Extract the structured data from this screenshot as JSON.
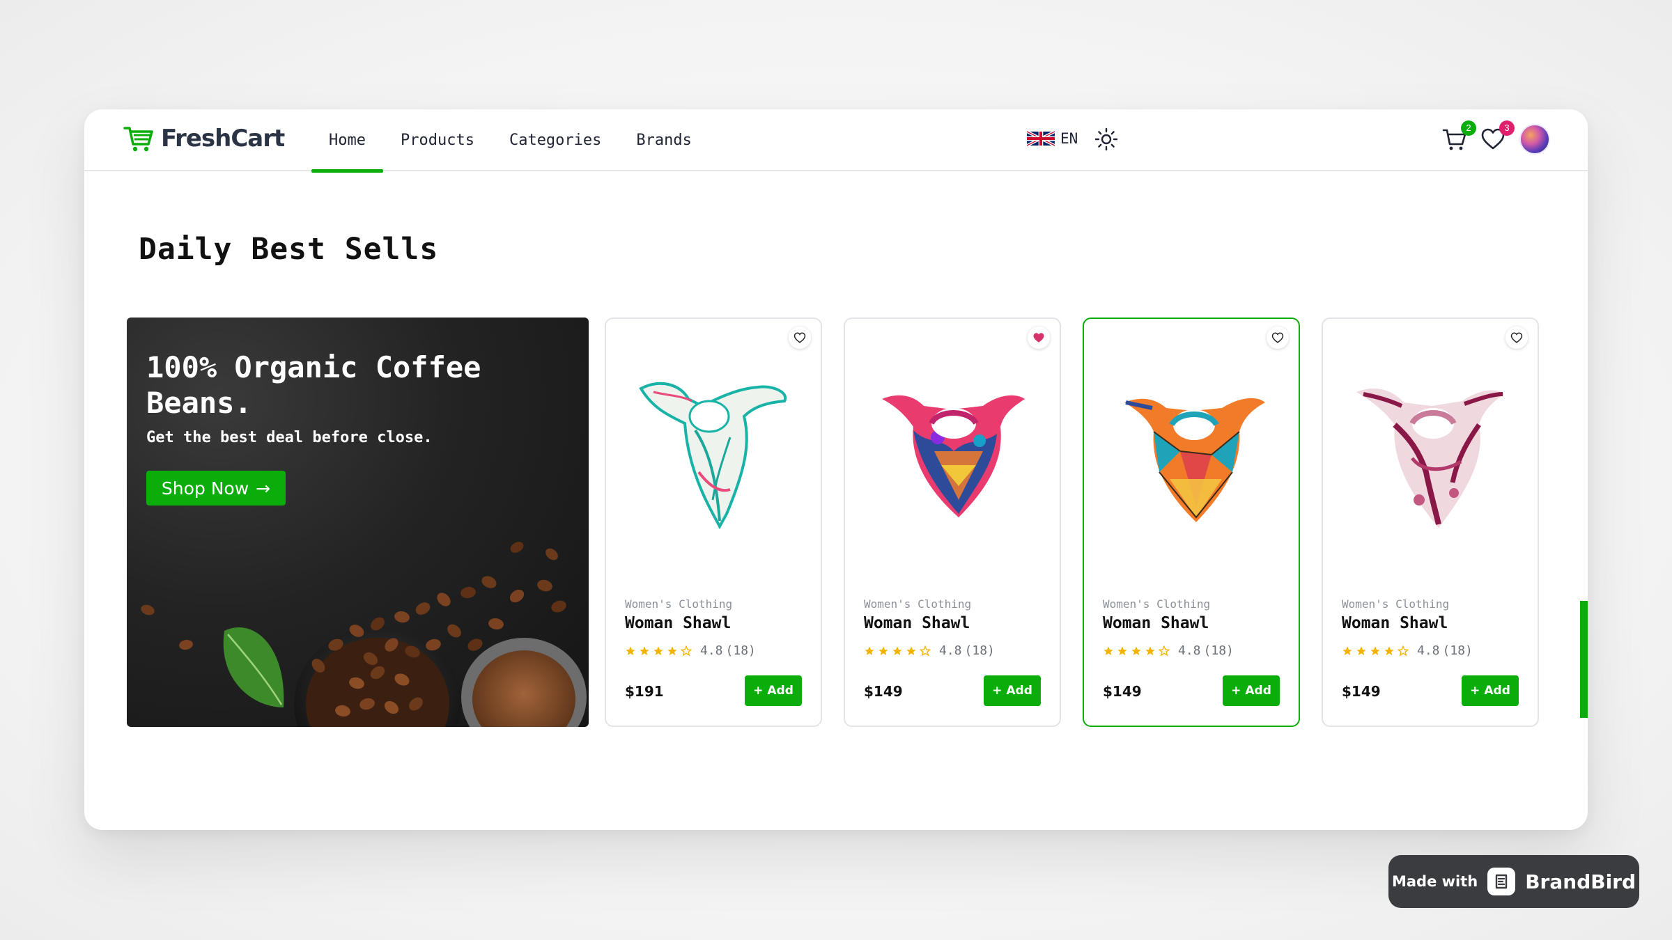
{
  "brand": {
    "name": "FreshCart",
    "accent": "#0aad0a"
  },
  "nav": {
    "links": [
      {
        "label": "Home",
        "active": true
      },
      {
        "label": "Products"
      },
      {
        "label": "Categories"
      },
      {
        "label": "Brands"
      }
    ],
    "language": "EN",
    "cart_count": "2",
    "wishlist_count": "3",
    "icons": [
      "uk-flag-icon",
      "sun-icon",
      "cart-icon",
      "heart-icon",
      "avatar"
    ]
  },
  "section": {
    "title": "Daily Best Sells"
  },
  "banner": {
    "title": "100% Organic Coffee Beans.",
    "subtitle": "Get the best deal before close.",
    "button": "Shop Now",
    "button_icon": "→"
  },
  "products": [
    {
      "category": "Women's Clothing",
      "name": "Woman Shawl",
      "rating": "4.8",
      "reviews": "(18)",
      "stars": 4,
      "price": "$191",
      "add": "Add",
      "wishlisted": false
    },
    {
      "category": "Women's Clothing",
      "name": "Woman Shawl",
      "rating": "4.8",
      "reviews": "(18)",
      "stars": 4,
      "price": "$149",
      "add": "Add",
      "wishlisted": true
    },
    {
      "category": "Women's Clothing",
      "name": "Woman Shawl",
      "rating": "4.8",
      "reviews": "(18)",
      "stars": 4,
      "price": "$149",
      "add": "Add",
      "wishlisted": false,
      "selected": true
    },
    {
      "category": "Women's Clothing",
      "name": "Woman Shawl",
      "rating": "4.8",
      "reviews": "(18)",
      "stars": 4,
      "price": "$149",
      "add": "Add",
      "wishlisted": false
    }
  ],
  "watermark": {
    "prefix": "Made with",
    "brand": "BrandBird"
  },
  "colors": {
    "green": "#0aad0a",
    "badge_green": "#0aad0a",
    "badge_pink": "#e0206d",
    "star": "#f5b301",
    "heart_filled": "#d6336c"
  }
}
